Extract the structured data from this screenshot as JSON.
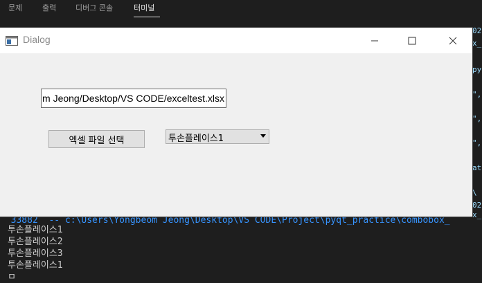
{
  "panel": {
    "tabs": [
      {
        "label": "문제"
      },
      {
        "label": "출력"
      },
      {
        "label": "디버그 콘솔"
      },
      {
        "label": "터미널"
      }
    ],
    "active_tab": "터미널"
  },
  "terminal": {
    "cut_line": "  33882  -- c:\\Users\\Yongbeom Jeong\\Desktop\\VS CODE\\Project\\pyqt_practice\\combobox_",
    "output_lines": [
      "투손플레이스1",
      "투손플레이스2",
      "투손플레이스3",
      "투손플레이스1"
    ],
    "peek": [
      "02",
      "x_",
      "py",
      "\",",
      "\",",
      "\",",
      "at",
      "\\",
      "02",
      "x_"
    ]
  },
  "dialog": {
    "title": "Dialog",
    "path_value": "C:/Users/Yongbeom Jeong/Desktop/VS CODE/exceltest.xlsx",
    "select_button_label": "엑셀 파일 선택",
    "combo_selected": "투손플레이스1"
  },
  "colors": {
    "editor_bg": "#1e1e1e",
    "dialog_bg": "#f0f0f0",
    "terminal_link": "#3794ff"
  }
}
